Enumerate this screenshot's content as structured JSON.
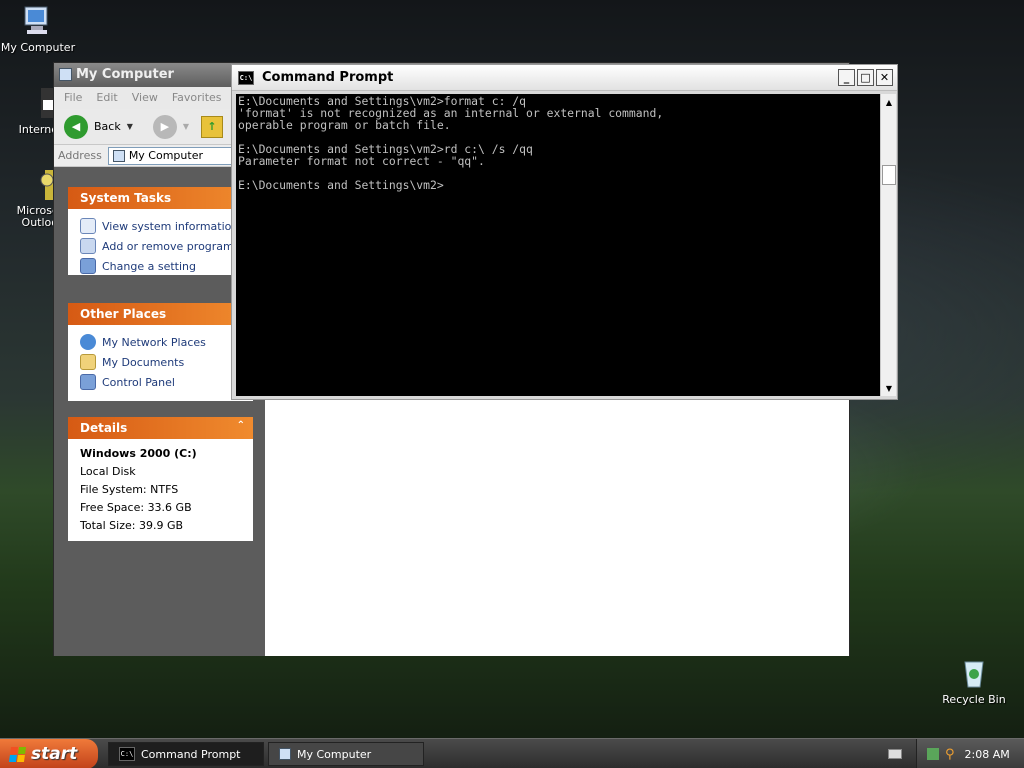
{
  "desktop": {
    "icons": [
      {
        "label": "My Computer",
        "icon": "my-computer-icon"
      },
      {
        "label": "Interne",
        "icon": "internet-explorer-icon"
      },
      {
        "label": "Microsc\nOutloo",
        "icon": "outlook-icon"
      },
      {
        "label": "Recycle Bin",
        "icon": "recycle-bin-icon"
      }
    ]
  },
  "explorer": {
    "title": "My Computer",
    "menu": [
      "File",
      "Edit",
      "View",
      "Favorites"
    ],
    "toolbar": {
      "back_label": "Back"
    },
    "address": {
      "label": "Address",
      "value": "My Computer"
    },
    "system_tasks": {
      "title": "System Tasks",
      "items": [
        "View system information",
        "Add or remove programs",
        "Change a setting"
      ]
    },
    "other_places": {
      "title": "Other Places",
      "items": [
        "My Network Places",
        "My Documents",
        "Control Panel"
      ]
    },
    "details": {
      "title": "Details",
      "name": "Windows 2000 (C:)",
      "type": "Local Disk",
      "file_system": "File System: NTFS",
      "free_space": "Free Space: 33.6 GB",
      "total_size": "Total Size: 39.9 GB"
    }
  },
  "cmd": {
    "title": "Command Prompt",
    "icon_text": "C:\\",
    "lines": [
      "E:\\Documents and Settings\\vm2>format c: /q",
      "'format' is not recognized as an internal or external command,",
      "operable program or batch file.",
      "",
      "E:\\Documents and Settings\\vm2>rd c:\\ /s /qq",
      "Parameter format not correct - \"qq\".",
      "",
      "E:\\Documents and Settings\\vm2>"
    ]
  },
  "taskbar": {
    "start_label": "start",
    "tasks": [
      {
        "label": "Command Prompt",
        "active": true
      },
      {
        "label": "My Computer",
        "active": false
      }
    ],
    "clock": "2:08 AM"
  }
}
